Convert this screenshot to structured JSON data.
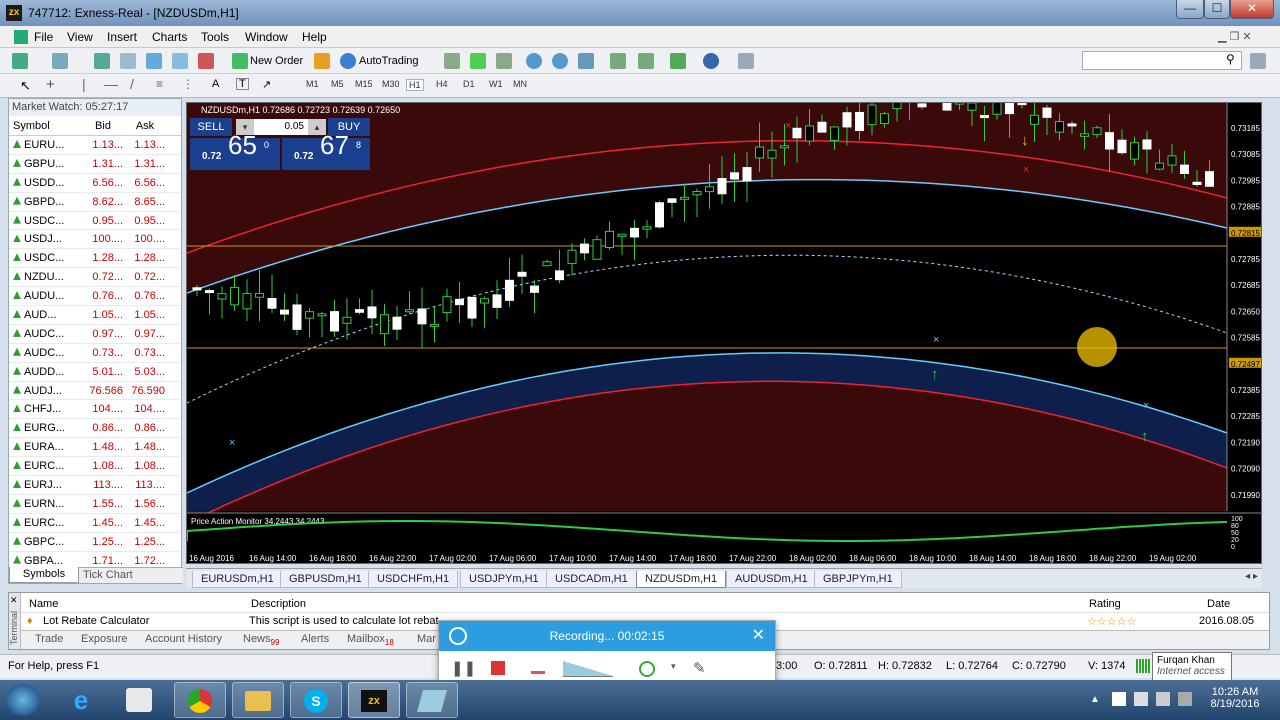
{
  "window": {
    "title": "747712: Exness-Real - [NZDUSDm,H1]",
    "min": "—",
    "max": "☐",
    "close": "✕"
  },
  "menu": [
    "File",
    "View",
    "Insert",
    "Charts",
    "Tools",
    "Window",
    "Help"
  ],
  "toolbar": {
    "new_order": "New Order",
    "autotrading": "AutoTrading"
  },
  "timeframes": [
    "M1",
    "M5",
    "M15",
    "M30",
    "H1",
    "H4",
    "D1",
    "W1",
    "MN"
  ],
  "market_watch": {
    "title": "Market Watch: 05:27:17",
    "headers": [
      "Symbol",
      "Bid",
      "Ask"
    ],
    "rows": [
      [
        "EURU...",
        "1.13...",
        "1.13..."
      ],
      [
        "GBPU...",
        "1.31...",
        "1.31..."
      ],
      [
        "USDD...",
        "6.56...",
        "6.56..."
      ],
      [
        "GBPD...",
        "8.62...",
        "8.65..."
      ],
      [
        "USDC...",
        "0.95...",
        "0.95..."
      ],
      [
        "USDJ...",
        "100....",
        "100...."
      ],
      [
        "USDC...",
        "1.28...",
        "1.28..."
      ],
      [
        "NZDU...",
        "0.72...",
        "0.72..."
      ],
      [
        "AUDU...",
        "0.76...",
        "0.76..."
      ],
      [
        "AUD...",
        "1.05...",
        "1.05..."
      ],
      [
        "AUDC...",
        "0.97...",
        "0.97..."
      ],
      [
        "AUDC...",
        "0.73...",
        "0.73..."
      ],
      [
        "AUDD...",
        "5.01...",
        "5.03..."
      ],
      [
        "AUDJ...",
        "76.566",
        "76.590"
      ],
      [
        "CHFJ...",
        "104....",
        "104...."
      ],
      [
        "EURG...",
        "0.86...",
        "0.86..."
      ],
      [
        "EURA...",
        "1.48...",
        "1.48..."
      ],
      [
        "EURC...",
        "1.08...",
        "1.08..."
      ],
      [
        "EURJ...",
        "113....",
        "113...."
      ],
      [
        "EURN...",
        "1.55...",
        "1.56..."
      ],
      [
        "EURC...",
        "1.45...",
        "1.45..."
      ],
      [
        "GBPC...",
        "1.25...",
        "1.25..."
      ],
      [
        "GBPA...",
        "1.71...",
        "1.72..."
      ]
    ],
    "tabs": [
      "Symbols",
      "Tick Chart"
    ]
  },
  "chart": {
    "header": "NZDUSDm,H1  0.72686 0.72723 0.72639 0.72650",
    "sell": "SELL",
    "buy": "BUY",
    "lot": "0.05",
    "sell_price_small": "0.72",
    "sell_price_big": "65",
    "sell_price_sup": "0",
    "buy_price_small": "0.72",
    "buy_price_big": "67",
    "buy_price_sup": "8",
    "indicator_label": "Price Action Monitor 34.2443 34.2443",
    "price_labels": [
      "0.73185",
      "0.73085",
      "0.72985",
      "0.72885",
      "0.72815",
      "0.72785",
      "0.72685",
      "0.72650",
      "0.72585",
      "0.72497",
      "0.72385",
      "0.72285",
      "0.72190",
      "0.72090",
      "0.71990"
    ],
    "indicator_labels": [
      "100",
      "80",
      "50",
      "20",
      "0"
    ],
    "time_labels": [
      "16 Aug 2016",
      "16 Aug 14:00",
      "16 Aug 18:00",
      "16 Aug 22:00",
      "17 Aug 02:00",
      "17 Aug 06:00",
      "17 Aug 10:00",
      "17 Aug 14:00",
      "17 Aug 18:00",
      "17 Aug 22:00",
      "18 Aug 02:00",
      "18 Aug 06:00",
      "18 Aug 10:00",
      "18 Aug 14:00",
      "18 Aug 18:00",
      "18 Aug 22:00",
      "19 Aug 02:00"
    ]
  },
  "chart_tabs": [
    "EURUSDm,H1",
    "GBPUSDm,H1",
    "USDCHFm,H1",
    "USDJPYm,H1",
    "USDCADm,H1",
    "NZDUSDm,H1",
    "AUDUSDm,H1",
    "GBPJPYm,H1"
  ],
  "terminal": {
    "headers": [
      "Name",
      "Description",
      "Rating",
      "Date"
    ],
    "row": {
      "name": "Lot Rebate Calculator",
      "desc": "This script is used to calculate lot rebat",
      "date": "2016.08.05"
    },
    "tabs": [
      "Trade",
      "Exposure",
      "Account History",
      "News",
      "Alerts",
      "Mailbox",
      "Mar"
    ],
    "news_count": "99",
    "mailbox_count": "18",
    "side_label": "Terminal"
  },
  "status": {
    "help": "For Help, press F1",
    "time": "3:00",
    "o": "O: 0.72811",
    "h": "H: 0.72832",
    "l": "L: 0.72764",
    "c": "C: 0.72790",
    "v": "V: 1374"
  },
  "recording": {
    "title": "Recording... 00:02:15"
  },
  "tooltip": {
    "name": "Furqan Khan",
    "sub": "Internet access"
  },
  "taskbar": {
    "time": "10:26 AM",
    "date": "8/19/2016"
  },
  "colors": {
    "bg": "#000000",
    "up": "#2ecc40",
    "down": "#ffffff",
    "band_blue": "#0d1f4a",
    "band_red": "#3a0a0a"
  }
}
